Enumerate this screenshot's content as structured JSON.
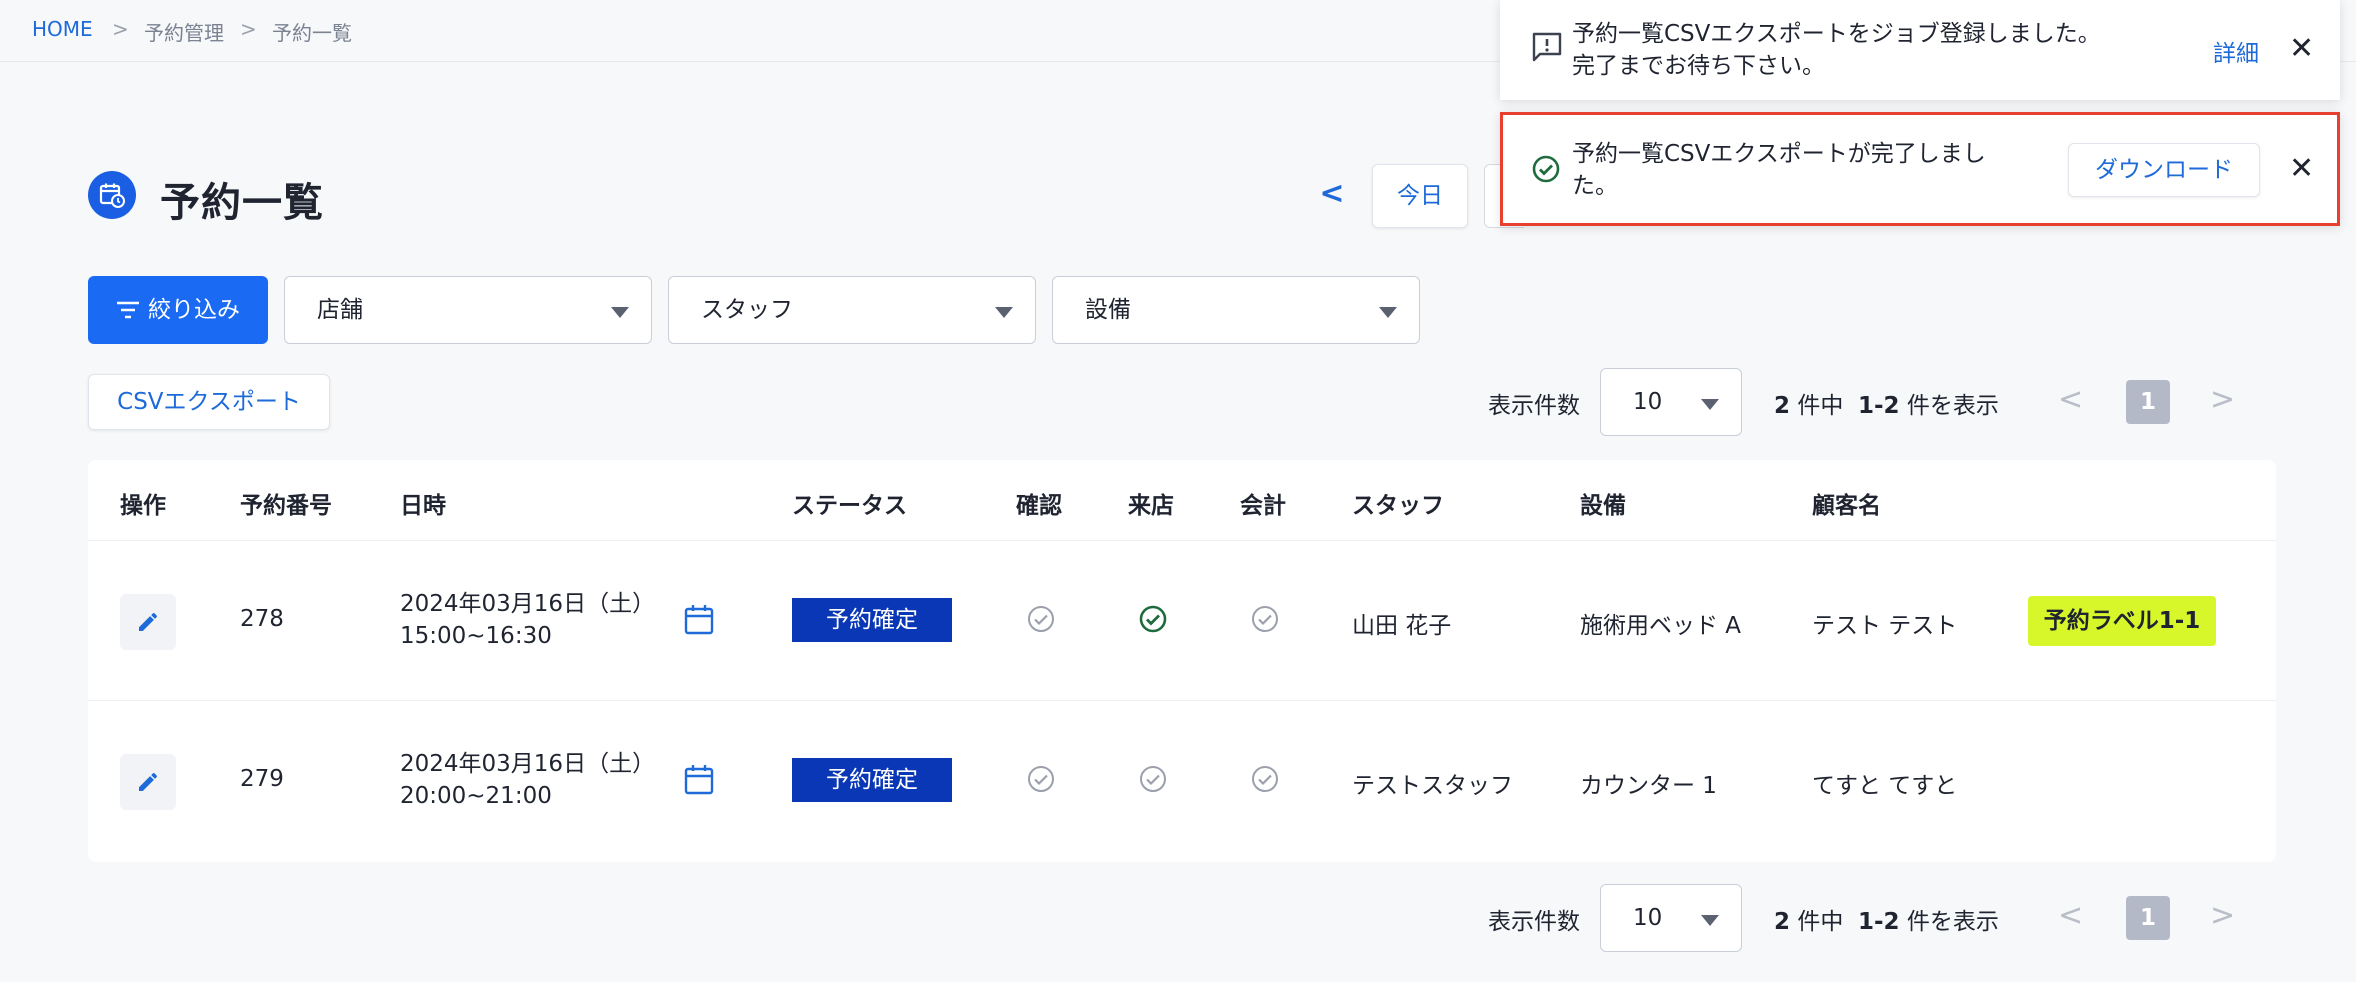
{
  "breadcrumb": {
    "home": "HOME",
    "level1": "予約管理",
    "level2": "予約一覧",
    "separator": ">"
  },
  "page": {
    "title": "予約一覧"
  },
  "nav": {
    "prev": "<",
    "today": "今日"
  },
  "filters": {
    "button_label": "絞り込み",
    "store": "店舗",
    "staff": "スタッフ",
    "equipment": "設備"
  },
  "csv_export": {
    "label": "CSVエクスポート"
  },
  "pagination": {
    "per_page_label": "表示件数",
    "per_page_value": "10",
    "total": "2",
    "total_suffix": "件中",
    "range": "1-2",
    "range_suffix": "件を表示",
    "prev": "<",
    "next": ">",
    "current_page": "1"
  },
  "table": {
    "headers": {
      "action": "操作",
      "number": "予約番号",
      "datetime": "日時",
      "status": "ステータス",
      "confirm": "確認",
      "visit": "来店",
      "payment": "会計",
      "staff": "スタッフ",
      "equipment": "設備",
      "customer": "顧客名"
    },
    "rows": [
      {
        "number": "278",
        "date": "2024年03月16日（土）",
        "time": "15:00~16:30",
        "status": "予約確定",
        "confirm": false,
        "visit": true,
        "payment": false,
        "staff": "山田 花子",
        "equipment": "施術用ベッド A",
        "customer": "テスト テスト",
        "label": "予約ラベル1-1"
      },
      {
        "number": "279",
        "date": "2024年03月16日（土）",
        "time": "20:00~21:00",
        "status": "予約確定",
        "confirm": false,
        "visit": false,
        "payment": false,
        "staff": "テストスタッフ",
        "equipment": "カウンター 1",
        "customer": "てすと てすと",
        "label": ""
      }
    ]
  },
  "toasts": [
    {
      "line1": "予約一覧CSVエクスポートをジョブ登録しました。",
      "line2": "完了までお待ち下さい。",
      "action": "詳細",
      "close": "✕",
      "icon": "info-message-icon"
    },
    {
      "line1": "予約一覧CSVエクスポートが完了しまし",
      "line2": "た。",
      "action": "ダウンロード",
      "close": "✕",
      "icon": "check-circle-icon"
    }
  ],
  "colors": {
    "primary": "#1a6af4",
    "link": "#1e6ad8",
    "status_confirmed": "#0a37b5",
    "label_tag": "#d7f72b",
    "check_active": "#1e6b3d",
    "check_inactive": "#9aa0ab",
    "toast_highlight": "#e8402f"
  }
}
